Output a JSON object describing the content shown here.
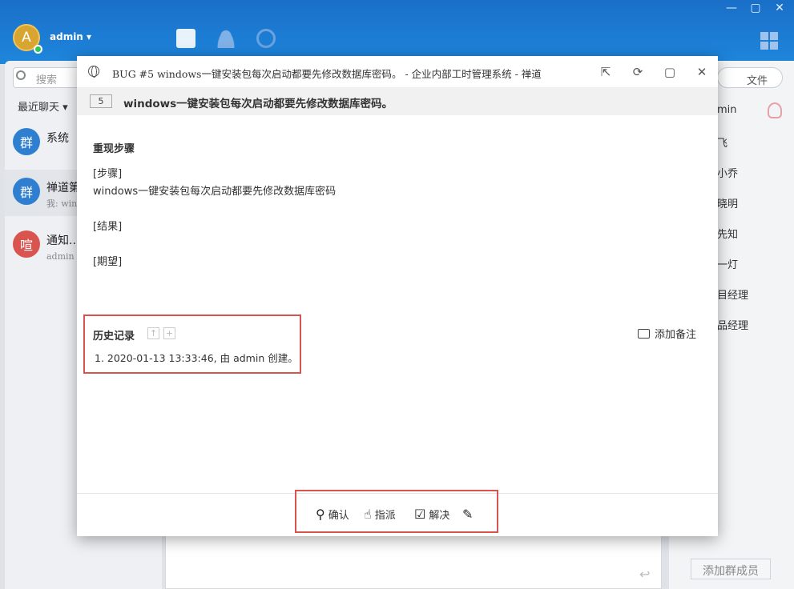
{
  "app": {
    "window_controls": [
      "—",
      "▢",
      "✕"
    ],
    "user": {
      "avatar_letter": "A",
      "name": "admin"
    },
    "search_placeholder": "搜索",
    "recent_label": "最近聊天",
    "conversations": [
      {
        "avatar": "群",
        "name": "系统",
        "preview": "",
        "color": "#2f7fd1"
      },
      {
        "avatar": "群",
        "name": "禅道第",
        "preview": "我: wind",
        "color": "#2f7fd1"
      },
      {
        "avatar": "喧",
        "name": "通知...",
        "preview": "admin 创",
        "color": "#d9534f"
      }
    ],
    "right_tab": "文件",
    "members": [
      "min",
      "飞",
      "小乔",
      "晓明",
      "先知",
      "一灯",
      "目经理",
      "品经理"
    ],
    "add_member_label": "添加群成员"
  },
  "dialog": {
    "title": "BUG #5 windows一键安装包每次启动都要先修改数据库密码。 - 企业内部工时管理系统 - 禅道",
    "bug_id": "5",
    "bug_title": "windows一键安装包每次启动都要先修改数据库密码。",
    "repro_heading": "重现步骤",
    "lines": [
      "[步骤]",
      "windows一键安装包每次启动都要先修改数据库密码",
      "[结果]",
      "[期望]"
    ],
    "history_heading": "历史记录",
    "history_item": "1. 2020-01-13 13:33:46, 由 admin 创建。",
    "add_note_label": "添加备注",
    "actions": {
      "confirm": "确认",
      "assign": "指派",
      "resolve": "解决"
    }
  }
}
